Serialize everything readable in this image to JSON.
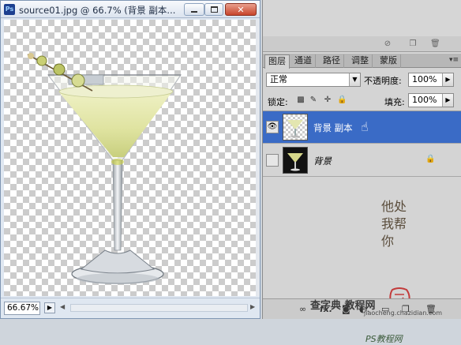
{
  "document": {
    "title": "source01.jpg @ 66.7% (背景 副本...",
    "zoom": "66.67%"
  },
  "layers_panel": {
    "tabs": [
      {
        "label": "图层",
        "active": true
      },
      {
        "label": "通道",
        "active": false
      },
      {
        "label": "路径",
        "active": false
      },
      {
        "label": "调整",
        "active": false
      },
      {
        "label": "蒙版",
        "active": false
      }
    ],
    "blend_mode": "正常",
    "opacity_label": "不透明度:",
    "opacity_value": "100%",
    "lock_label": "锁定:",
    "fill_label": "填充:",
    "fill_value": "100%",
    "layers": [
      {
        "name": "背景 副本",
        "selected": true,
        "visible": true
      },
      {
        "name": "背景",
        "selected": false,
        "visible": false,
        "locked": true
      }
    ]
  },
  "watermarks": {
    "vertical_text": "他处我帮你",
    "site": "PS教程网",
    "bottom": "查字典 教程网",
    "bottom_url": "jiaocheng.chazidian.com",
    "site_url": "www.tata580.com"
  },
  "colors": {
    "selection": "#3a6bc6",
    "panel_bg": "#d4d4d4",
    "window_chrome": "#dfe7f1"
  },
  "icons": {
    "layer_visibility": "eye-icon",
    "background_lock": "lock-icon",
    "footer": [
      "link-icon",
      "fx-icon",
      "mask-icon",
      "adjustment-icon",
      "group-icon",
      "new-layer-icon",
      "trash-icon"
    ]
  }
}
